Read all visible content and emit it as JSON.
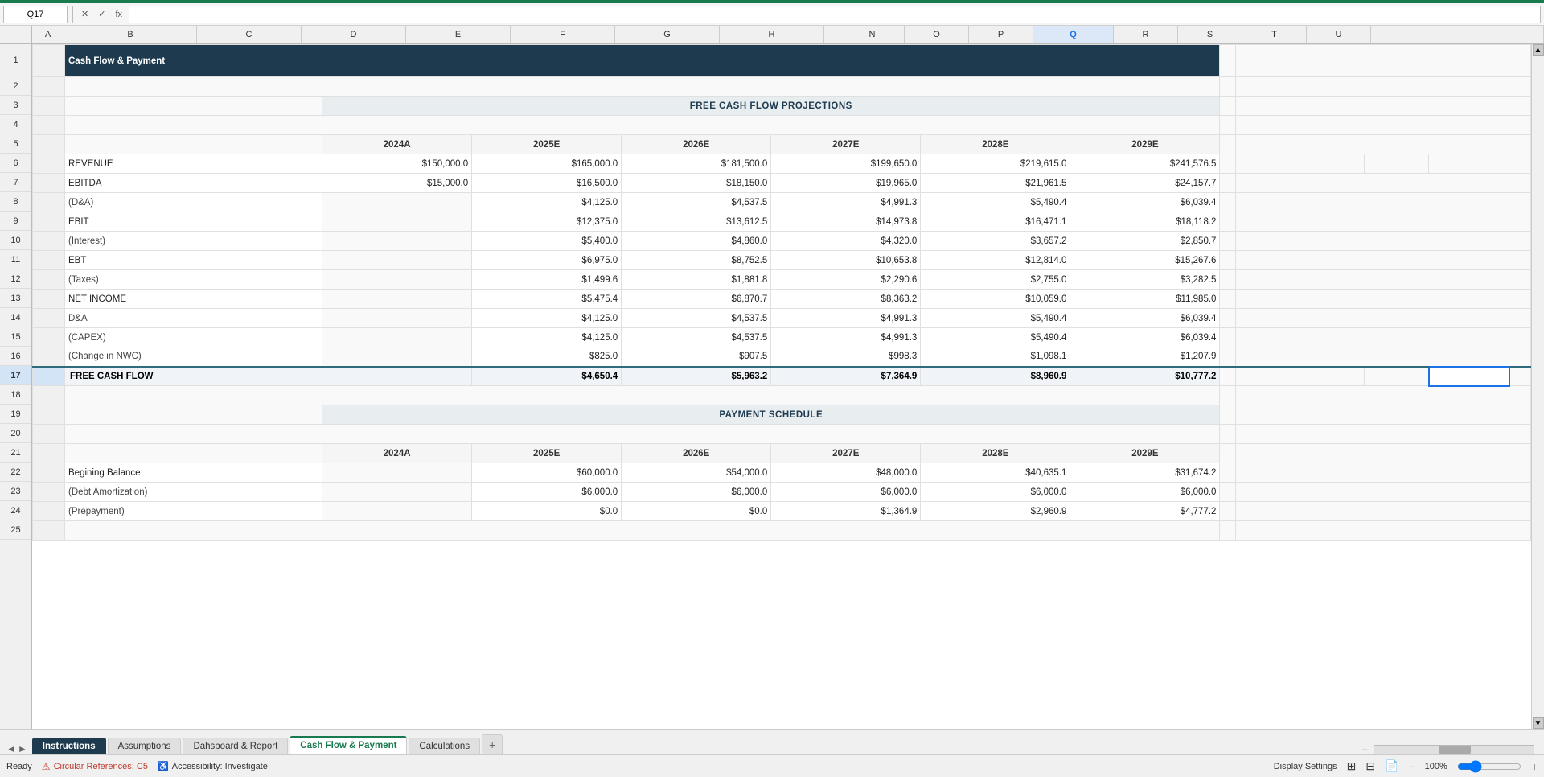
{
  "formulaBar": {
    "nameBox": "Q17",
    "cancelIcon": "✕",
    "confirmIcon": "✓",
    "fxIcon": "fx",
    "formulaValue": ""
  },
  "title": "Cash Flow & Payment",
  "sections": {
    "freeCashFlow": {
      "header": "FREE CASH FLOW PROJECTIONS",
      "columns": [
        "",
        "2024A",
        "2025E",
        "2026E",
        "2027E",
        "2028E",
        "2029E"
      ],
      "rows": [
        {
          "label": "REVENUE",
          "indent": false,
          "values": [
            "$150,000.0",
            "$165,000.0",
            "$181,500.0",
            "$199,650.0",
            "$219,615.0",
            "$241,576.5"
          ]
        },
        {
          "label": "EBITDA",
          "indent": false,
          "values": [
            "$15,000.0",
            "$16,500.0",
            "$18,150.0",
            "$19,965.0",
            "$21,961.5",
            "$24,157.7"
          ]
        },
        {
          "label": "(D&A)",
          "indent": true,
          "values": [
            "",
            "$4,125.0",
            "$4,537.5",
            "$4,991.3",
            "$5,490.4",
            "$6,039.4"
          ]
        },
        {
          "label": "EBIT",
          "indent": false,
          "values": [
            "",
            "$12,375.0",
            "$13,612.5",
            "$14,973.8",
            "$16,471.1",
            "$18,118.2"
          ]
        },
        {
          "label": "(Interest)",
          "indent": true,
          "values": [
            "",
            "$5,400.0",
            "$4,860.0",
            "$4,320.0",
            "$3,657.2",
            "$2,850.7"
          ]
        },
        {
          "label": "EBT",
          "indent": false,
          "values": [
            "",
            "$6,975.0",
            "$8,752.5",
            "$10,653.8",
            "$12,814.0",
            "$15,267.6"
          ]
        },
        {
          "label": "(Taxes)",
          "indent": true,
          "values": [
            "",
            "$1,499.6",
            "$1,881.8",
            "$2,290.6",
            "$2,755.0",
            "$3,282.5"
          ]
        },
        {
          "label": "NET INCOME",
          "indent": false,
          "values": [
            "",
            "$5,475.4",
            "$6,870.7",
            "$8,363.2",
            "$10,059.0",
            "$11,985.0"
          ]
        },
        {
          "label": "D&A",
          "indent": true,
          "values": [
            "",
            "$4,125.0",
            "$4,537.5",
            "$4,991.3",
            "$5,490.4",
            "$6,039.4"
          ]
        },
        {
          "label": "(CAPEX)",
          "indent": true,
          "values": [
            "",
            "$4,125.0",
            "$4,537.5",
            "$4,991.3",
            "$5,490.4",
            "$6,039.4"
          ]
        },
        {
          "label": "(Change in NWC)",
          "indent": true,
          "values": [
            "",
            "$825.0",
            "$907.5",
            "$998.3",
            "$1,098.1",
            "$1,207.9"
          ]
        },
        {
          "label": "FREE CASH FLOW",
          "indent": false,
          "bold": true,
          "values": [
            "",
            "$4,650.4",
            "$5,963.2",
            "$7,364.9",
            "$8,960.9",
            "$10,777.2"
          ]
        }
      ]
    },
    "paymentSchedule": {
      "header": "PAYMENT SCHEDULE",
      "columns": [
        "",
        "2024A",
        "2025E",
        "2026E",
        "2027E",
        "2028E",
        "2029E"
      ],
      "rows": [
        {
          "label": "Begining Balance",
          "indent": false,
          "values": [
            "",
            "$60,000.0",
            "$54,000.0",
            "$48,000.0",
            "$40,635.1",
            "$31,674.2"
          ]
        },
        {
          "label": "(Debt Amortization)",
          "indent": true,
          "values": [
            "",
            "$6,000.0",
            "$6,000.0",
            "$6,000.0",
            "$6,000.0",
            "$6,000.0"
          ]
        },
        {
          "label": "(Prepayment)",
          "indent": true,
          "values": [
            "",
            "$0.0",
            "$0.0",
            "$1,364.9",
            "$2,960.9",
            "$4,777.2"
          ]
        }
      ]
    }
  },
  "rowNumbers": [
    "1",
    "2",
    "3",
    "4",
    "5",
    "6",
    "7",
    "8",
    "9",
    "10",
    "11",
    "12",
    "13",
    "14",
    "15",
    "16",
    "17",
    "18",
    "19",
    "20",
    "21",
    "22",
    "23",
    "24",
    "25"
  ],
  "colHeaders": [
    "A",
    "B",
    "C",
    "D",
    "E",
    "F",
    "G",
    "H",
    "",
    "N",
    "O",
    "P",
    "Q",
    "R",
    "S",
    "T",
    "U"
  ],
  "tabs": [
    {
      "label": "Instructions",
      "type": "dark"
    },
    {
      "label": "Assumptions",
      "type": "normal"
    },
    {
      "label": "Dahsboard & Report",
      "type": "normal"
    },
    {
      "label": "Cash Flow & Payment",
      "type": "active"
    },
    {
      "label": "Calculations",
      "type": "normal"
    }
  ],
  "statusBar": {
    "ready": "Ready",
    "circRef": "Circular References: C5",
    "accessibility": "Accessibility: Investigate"
  },
  "zoomLevel": "100%",
  "selectedCell": "Q17"
}
